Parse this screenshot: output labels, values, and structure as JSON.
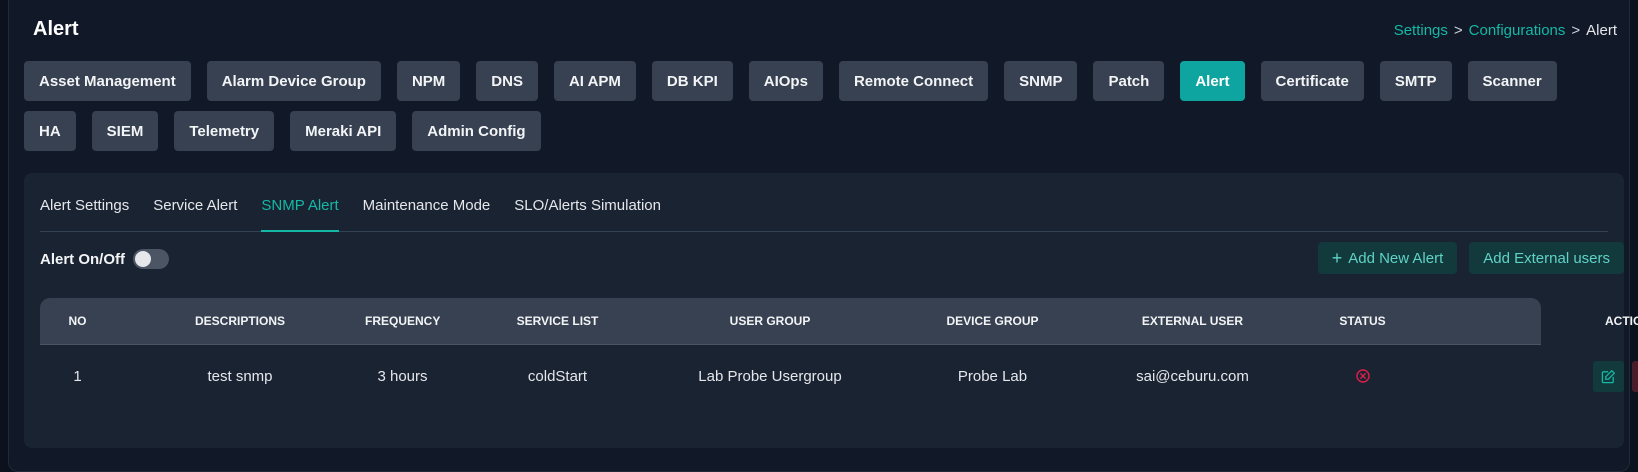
{
  "page": {
    "title": "Alert"
  },
  "breadcrumb": {
    "items": [
      "Settings",
      "Configurations"
    ],
    "separator": ">",
    "current": "Alert"
  },
  "nav": {
    "buttons": [
      "Asset Management",
      "Alarm Device Group",
      "NPM",
      "DNS",
      "AI APM",
      "DB KPI",
      "AIOps",
      "Remote Connect",
      "SNMP",
      "Patch",
      "Alert",
      "Certificate",
      "SMTP",
      "Scanner",
      "HA",
      "SIEM",
      "Telemetry",
      "Meraki API",
      "Admin Config"
    ],
    "active": "Alert"
  },
  "tabs": {
    "items": [
      "Alert Settings",
      "Service Alert",
      "SNMP Alert",
      "Maintenance Mode",
      "SLO/Alerts Simulation"
    ],
    "active": "SNMP Alert"
  },
  "toggle": {
    "label": "Alert On/Off",
    "state": "off"
  },
  "actions": {
    "add_new_alert": "Add New Alert",
    "add_external_users": "Add External users"
  },
  "table": {
    "columns": [
      "NO",
      "DESCRIPTIONS",
      "FREQUENCY",
      "SERVICE LIST",
      "USER GROUP",
      "DEVICE GROUP",
      "EXTERNAL USER",
      "STATUS",
      "ACTION"
    ],
    "rows": [
      {
        "no": "1",
        "description": "test snmp",
        "frequency": "3 hours",
        "service_list": "coldStart",
        "user_group": "Lab Probe Usergroup",
        "device_group": "Probe Lab",
        "external_user": "sai@ceburu.com",
        "status": "inactive"
      }
    ]
  },
  "colors": {
    "accent": "#14b8a6",
    "active_button": "#0ea5a0",
    "danger": "#e11d48"
  },
  "icons": {
    "add": "plus-icon",
    "status": "x-circle-icon",
    "edit": "edit-icon",
    "delete": "trash-icon"
  }
}
